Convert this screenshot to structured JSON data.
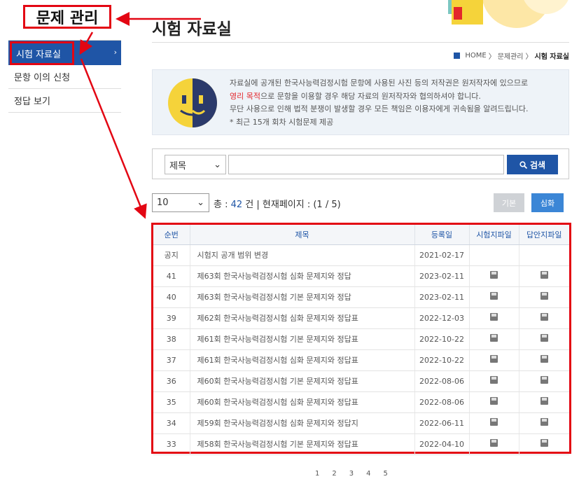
{
  "annotation": {
    "title": "문제 관리"
  },
  "sidebar": {
    "items": [
      {
        "label": "시험 자료실",
        "chevron": "›"
      },
      {
        "label": "문항 이의 신청"
      },
      {
        "label": "정답 보기"
      }
    ]
  },
  "page": {
    "title": "시험 자료실"
  },
  "breadcrumb": {
    "home": "HOME",
    "sep": "〉",
    "level1": "문제관리",
    "current": "시험 자료실"
  },
  "notice": {
    "line1": "자료실에 공개된 한국사능력검정시험 문항에 사용된 사진 등의 저작권은 원저작자에 있으므로",
    "line2_red": "영리 목적",
    "line2_rest": "으로 문항을 이용할 경우 해당 자료의 원저작자와 협의하셔야 합니다.",
    "line3": "무단 사용으로 인해 법적 분쟁이 발생할 경우 모든 책임은 이용자에게 귀속됨을 알려드립니다.",
    "line4": "* 최근 15개 회차 시험문제 제공"
  },
  "search": {
    "field_selected": "제목",
    "value": "",
    "button_label": "검색"
  },
  "list_controls": {
    "page_size": "10",
    "total_prefix": "총 : ",
    "total_count": "42",
    "total_suffix": " 건 | 현재페이지 : (1 / 5)",
    "basic_label": "기본",
    "advanced_label": "심화"
  },
  "table": {
    "headers": [
      "순번",
      "제목",
      "등록일",
      "시험지파일",
      "답안지파일"
    ],
    "rows": [
      {
        "no": "공지",
        "title": "시험지 공개 범위 변경",
        "date": "2021-02-17",
        "files": false
      },
      {
        "no": "41",
        "title": "제63회 한국사능력검정시험 심화 문제지와 정답",
        "date": "2023-02-11",
        "files": true
      },
      {
        "no": "40",
        "title": "제63회 한국사능력검정시험 기본 문제지와 정답",
        "date": "2023-02-11",
        "files": true
      },
      {
        "no": "39",
        "title": "제62회 한국사능력검정시험 심화 문제지와 정답표",
        "date": "2022-12-03",
        "files": true
      },
      {
        "no": "38",
        "title": "제61회 한국사능력검정시험 기본 문제지와 정답표",
        "date": "2022-10-22",
        "files": true
      },
      {
        "no": "37",
        "title": "제61회 한국사능력검정시험 심화 문제지와 정답표",
        "date": "2022-10-22",
        "files": true
      },
      {
        "no": "36",
        "title": "제60회 한국사능력검정시험 기본 문제지와 정답표",
        "date": "2022-08-06",
        "files": true
      },
      {
        "no": "35",
        "title": "제60회 한국사능력검정시험 심화 문제지와 정답표",
        "date": "2022-08-06",
        "files": true
      },
      {
        "no": "34",
        "title": "제59회 한국사능력검정시험 심화 문제지와 정답지",
        "date": "2022-06-11",
        "files": true
      },
      {
        "no": "33",
        "title": "제58회 한국사능력검정시험 기본 문제지와 정답표",
        "date": "2022-04-10",
        "files": true
      }
    ]
  },
  "pagination": [
    "1",
    "2",
    "3",
    "4",
    "5"
  ],
  "colors": {
    "primary": "#1f55a6",
    "annotation": "#e30613",
    "accent_red": "#e3262b"
  }
}
